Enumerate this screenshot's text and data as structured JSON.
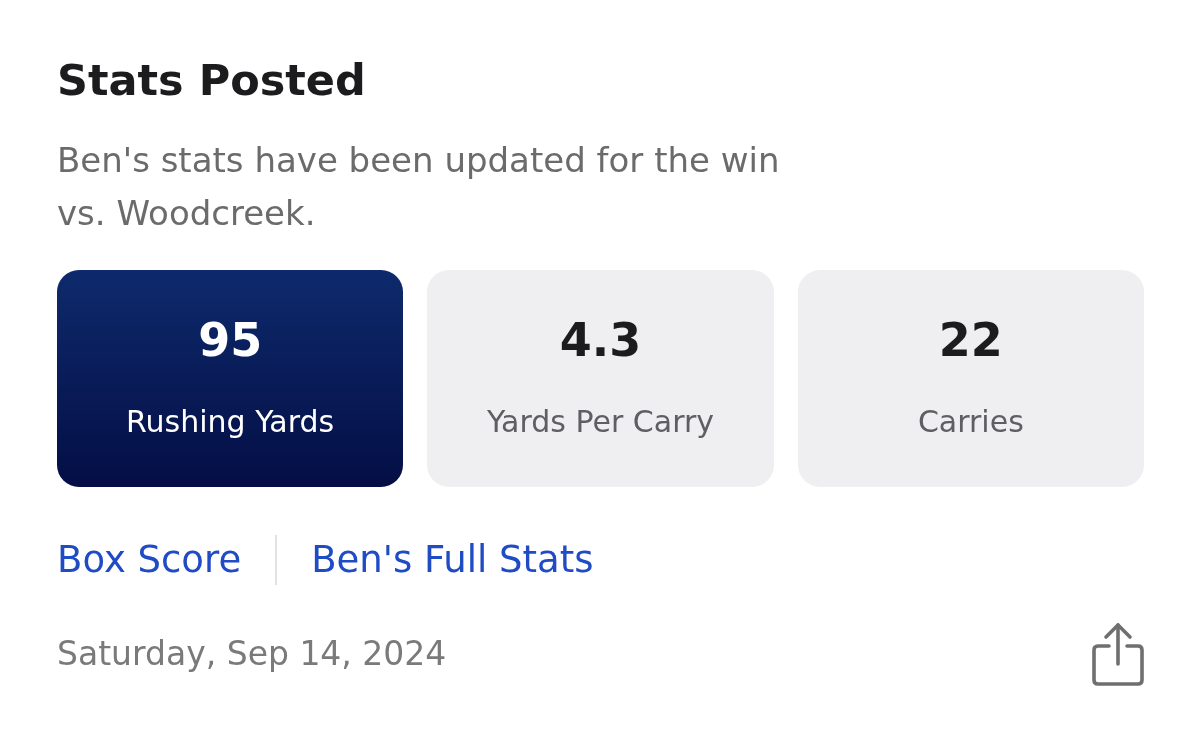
{
  "title": "Stats Posted",
  "message": "Ben's stats have been updated for the win vs. Woodcreek.",
  "stats": [
    {
      "value": "95",
      "label": "Rushing Yards",
      "highlighted": true
    },
    {
      "value": "4.3",
      "label": "Yards Per Carry",
      "highlighted": false
    },
    {
      "value": "22",
      "label": "Carries",
      "highlighted": false
    }
  ],
  "links": [
    "Box Score",
    "Ben's Full Stats"
  ],
  "date": "Saturday, Sep 14, 2024"
}
